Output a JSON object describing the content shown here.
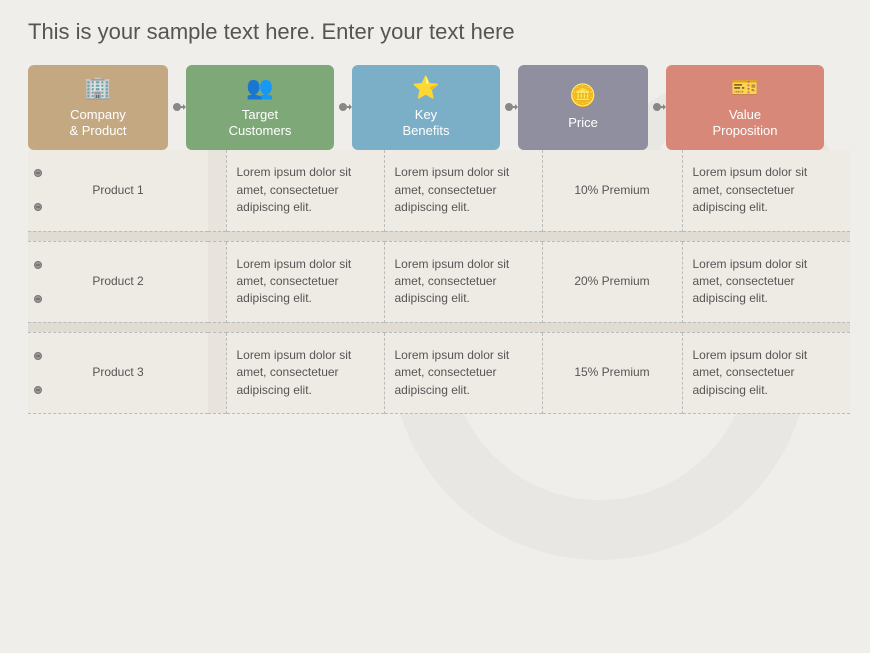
{
  "title": "This is your sample text here. Enter your text here",
  "headers": [
    {
      "id": "company",
      "label": "Company\n& Product",
      "icon": "🏢",
      "color": "#c4a882"
    },
    {
      "id": "customers",
      "label": "Target\nCustomers",
      "icon": "👥",
      "color": "#7fa878"
    },
    {
      "id": "benefits",
      "label": "Key\nBenefits",
      "icon": "⭐",
      "color": "#7bafc8"
    },
    {
      "id": "price",
      "label": "Price",
      "icon": "💰",
      "color": "#8f8fa0"
    },
    {
      "id": "value",
      "label": "Value\nProposition",
      "icon": "🎫",
      "color": "#d88878"
    }
  ],
  "rows": [
    {
      "product": "Product 1",
      "customers_text": "Lorem ipsum dolor sit amet, consectetuer adipiscing elit.",
      "benefits_text": "Lorem ipsum dolor sit amet, consectetuer adipiscing elit.",
      "price": "10% Premium",
      "value_text": "Lorem ipsum dolor sit amet, consectetuer adipiscing elit."
    },
    {
      "product": "Product 2",
      "customers_text": "Lorem ipsum dolor sit amet, consectetuer adipiscing elit.",
      "benefits_text": "Lorem ipsum dolor sit amet, consectetuer adipiscing elit.",
      "price": "20% Premium",
      "value_text": "Lorem ipsum dolor sit amet, consectetuer adipiscing elit."
    },
    {
      "product": "Product 3",
      "customers_text": "Lorem ipsum dolor sit amet, consectetuer adipiscing elit.",
      "benefits_text": "Lorem ipsum dolor sit amet, consectetuer adipiscing elit.",
      "price": "15% Premium",
      "value_text": "Lorem ipsum dolor sit amet, consectetuer adipiscing elit."
    }
  ],
  "arrow_symbol": "→"
}
